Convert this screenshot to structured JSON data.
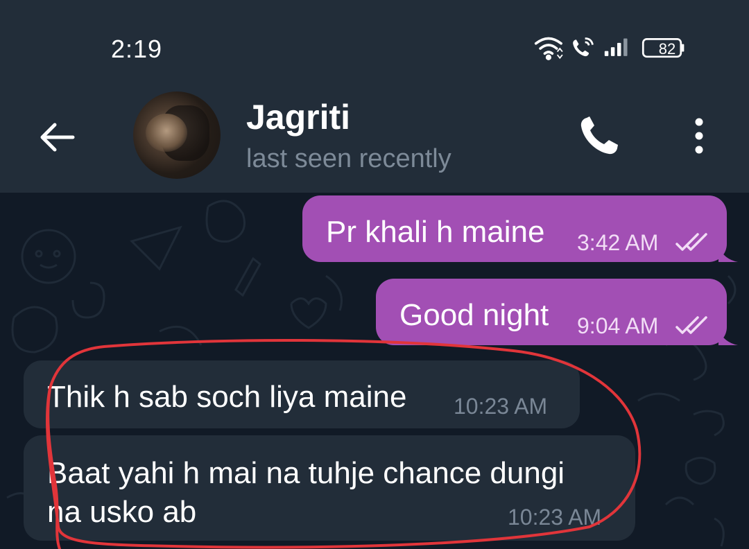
{
  "status_bar": {
    "time": "2:19",
    "battery": "82",
    "icons": [
      "wifi-icon",
      "wifi-calling-icon",
      "signal-icon",
      "battery-icon"
    ]
  },
  "header": {
    "contact_name": "Jagriti",
    "status": "last seen recently",
    "icons": [
      "back-arrow-icon",
      "avatar",
      "phone-icon",
      "more-vert-icon"
    ]
  },
  "colors": {
    "bar_bg": "#222d39",
    "chat_bg": "#111a26",
    "outgoing_bubble": "#a24fb4",
    "incoming_bubble": "#222d39",
    "annotation": "#e1353a"
  },
  "messages": [
    {
      "direction": "outgoing",
      "text": "Pr khali h maine",
      "time": "3:42 AM",
      "read": true
    },
    {
      "direction": "outgoing",
      "text": "Good night",
      "time": "9:04 AM",
      "read": true
    },
    {
      "direction": "incoming",
      "text": "Thik h sab soch liya maine",
      "time": "10:23 AM"
    },
    {
      "direction": "incoming",
      "text_line1": "Baat yahi h mai na tuhje chance dungi",
      "text_line2": "na usko ab",
      "time": "10:23 AM"
    }
  ]
}
